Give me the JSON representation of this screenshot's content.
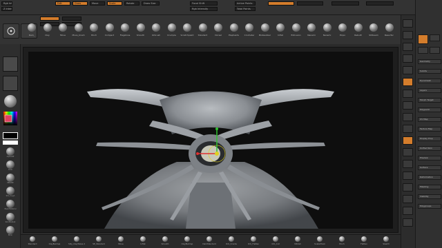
{
  "colors": {
    "accent": "#d47d2c",
    "panel": "#333333",
    "viewport_bg": "#0e0e0e",
    "gizmo_x": "#e03030",
    "gizmo_y": "#30c030",
    "gizmo_z": "#3060e0",
    "gizmo_center": "#e0d020"
  },
  "brushes": [
    {
      "label": "Dam_",
      "icon": "brush-ball-icon"
    },
    {
      "label": "Clay",
      "icon": "brush-ball-icon"
    },
    {
      "label": "Move",
      "icon": "brush-ball-icon"
    },
    {
      "label": "Move_brush",
      "icon": "brush-ball-icon"
    },
    {
      "label": "Pinch",
      "icon": "brush-ball-icon"
    },
    {
      "label": "Compact",
      "icon": "brush-ball-icon"
    },
    {
      "label": "Flagstone",
      "icon": "brush-ball-icon"
    },
    {
      "label": "Smooth",
      "icon": "brush-ball-icon"
    },
    {
      "label": "Orbrush",
      "icon": "brush-ball-icon"
    },
    {
      "label": "Crumple",
      "icon": "brush-ball-icon"
    },
    {
      "label": "Scratchpaint",
      "icon": "brush-ball-icon"
    },
    {
      "label": "Standard",
      "icon": "brush-ball-icon"
    },
    {
      "label": "Dorsal",
      "icon": "brush-ball-icon"
    },
    {
      "label": "Elephants",
      "icon": "brush-ball-icon"
    },
    {
      "label": "Crocheter",
      "icon": "brush-ball-icon"
    },
    {
      "label": "Blobsubber",
      "icon": "brush-ball-icon"
    },
    {
      "label": "Inflat",
      "icon": "brush-ball-icon"
    },
    {
      "label": "Extrusion",
      "icon": "brush-ball-icon"
    },
    {
      "label": "Nanami",
      "icon": "brush-ball-icon"
    },
    {
      "label": "Nanami",
      "icon": "brush-ball-icon"
    },
    {
      "label": "Pinpo",
      "icon": "brush-ball-icon"
    },
    {
      "label": "Rebuilt",
      "icon": "brush-ball-icon"
    },
    {
      "label": "Shtbeam",
      "icon": "brush-ball-icon"
    },
    {
      "label": "Resurfac",
      "icon": "brush-ball-icon"
    }
  ],
  "bottom_brushes": [
    "Standard",
    "ClayBuildup",
    "Silly_ClayTubes 2",
    "SE_Standard",
    "Move",
    "Inflat",
    "Smooth",
    "ClayBuildup",
    "DamStandard",
    "Orb_Cracks",
    "Orb_Flatten",
    "Orb_Cut",
    "hPolish",
    "SnakeHook",
    "Pinch",
    "Flatten",
    "Slash3"
  ],
  "left_thumbs": [
    "AlphaOff",
    "Dots",
    "MRGBZ",
    "Std_rough",
    "BasicMaterial",
    "SkinShade4",
    "Blinn"
  ],
  "tray_items": [
    "Geometry",
    "Subdiv",
    "Dynamesh",
    "Layers",
    "Morph Target",
    "Polypaint",
    "UV Map",
    "Texture Map",
    "Display Prop",
    "Unified Skin",
    "Preview",
    "Surface",
    "Deformation",
    "Masking",
    "Visibility",
    "Polygroups"
  ],
  "tray_title": "Lightbox",
  "top_cells": [
    "Rgb Intensity",
    "Z Intensity",
    "Draw Size",
    "Focal Shift",
    "Active Points",
    "Total Points",
    "Edit",
    "Draw",
    "Move",
    "Scale",
    "Rotate"
  ]
}
